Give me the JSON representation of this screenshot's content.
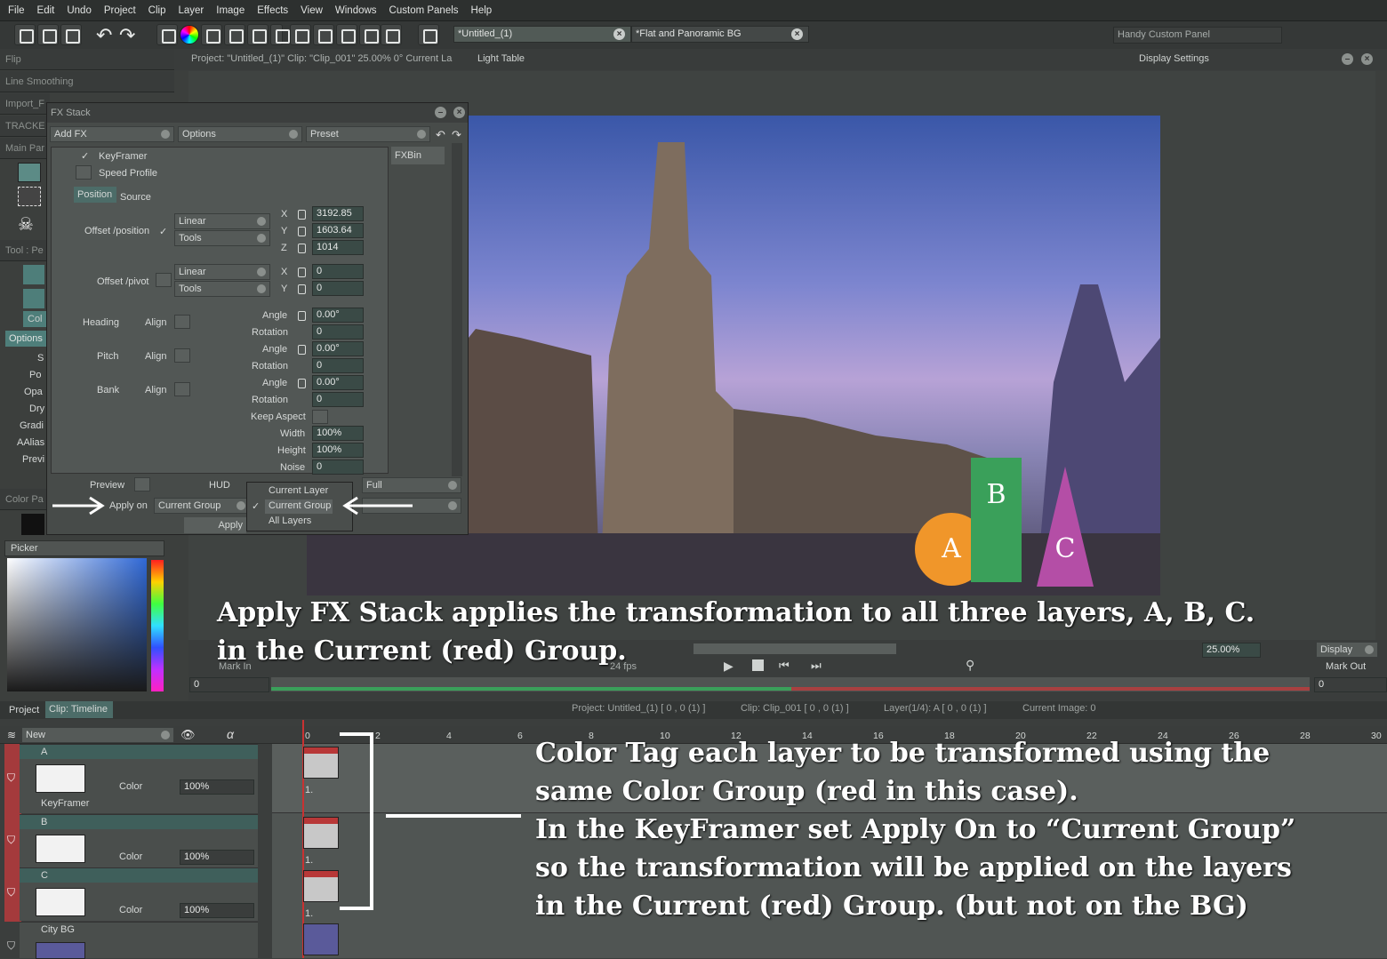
{
  "menu": [
    "File",
    "Edit",
    "Undo",
    "Project",
    "Clip",
    "Layer",
    "Image",
    "Effects",
    "View",
    "Windows",
    "Custom Panels",
    "Help"
  ],
  "tabs": {
    "untitled": "*Untitled_(1)",
    "flat_bg": "*Flat and Panoramic BG",
    "handy": "Handy Custom Panel"
  },
  "left_panels": [
    "Flip",
    "Line Smoothing",
    "Import_F",
    "TRACKE",
    "Main Par"
  ],
  "tool_panel": {
    "title": "Tool : Pe",
    "items": [
      "Col",
      "Options",
      "S",
      "Po",
      "Opa",
      "Dry",
      "Gradi",
      "AAlias",
      "Previ"
    ]
  },
  "color_panel": {
    "title": "Color Pa",
    "picker": "Picker"
  },
  "info_bar": {
    "text": "Project:  \"Untitled_(1)\"  Clip: \"Clip_001\"  25.00%   0°  Current La",
    "light_table": "Light Table",
    "display_settings": "Display Settings"
  },
  "fx": {
    "title": "FX Stack",
    "add_fx": "Add FX",
    "options": "Options",
    "preset": "Preset",
    "fxbin": "FXBin",
    "keyframer": "KeyFramer",
    "speed_profile": "Speed Profile",
    "tab_position": "Position",
    "tab_source": "Source",
    "offset_position": "Offset /position",
    "offset_pivot": "Offset /pivot",
    "linear": "Linear",
    "tools": "Tools",
    "x": "X",
    "y": "Y",
    "z": "Z",
    "pos_x": "3192.85",
    "pos_y": "1603.64",
    "pos_z": "1014",
    "piv_x": "0",
    "piv_y": "0",
    "heading": "Heading",
    "pitch": "Pitch",
    "bank": "Bank",
    "align": "Align",
    "angle": "Angle",
    "rotation": "Rotation",
    "heading_angle": "0.00°",
    "heading_rot": "0",
    "pitch_angle": "0.00°",
    "pitch_rot": "0",
    "bank_angle": "0.00°",
    "bank_rot": "0",
    "keep_aspect": "Keep Aspect",
    "width": "Width",
    "height": "Height",
    "noise": "Noise",
    "width_val": "100%",
    "height_val": "100%",
    "noise_val": "0",
    "preview": "Preview",
    "hud": "HUD",
    "full": "Full",
    "apply_on": "Apply on",
    "apply_on_value": "Current Group",
    "apply": "Apply",
    "menu_options": [
      "Current Layer",
      "Current Group",
      "All Layers"
    ]
  },
  "canvas": {
    "shape_a": "A",
    "shape_b": "B",
    "shape_c": "C"
  },
  "canvas_colors": {
    "a": "#f0962a",
    "b": "#3aa05a",
    "c": "#b44ea6"
  },
  "captions": {
    "top_line1": "Apply FX Stack applies the transformation to all three layers, A, B, C.",
    "top_line2": "in the Current (red) Group.",
    "right_line1": "Color Tag each layer to be transformed using the",
    "right_line2": "same Color Group (red in this case).",
    "right_line3": "In the KeyFramer set Apply On to “Current Group”",
    "right_line4": "so the transformation will be applied on the layers",
    "right_line5": "in the Current (red) Group. (but not on the BG)"
  },
  "transport": {
    "mark_in": "Mark In",
    "mark_out": "Mark Out",
    "in_val": "0",
    "out_val": "0",
    "fps": "24 fps",
    "zoom": "25.00%",
    "display": "Display"
  },
  "timeline": {
    "project_tab": "Project",
    "clip_tab": "Clip: Timeline",
    "status": [
      "Project: Untitled_(1) [ 0 , 0  (1) ]",
      "Clip: Clip_001 [ 0 , 0  (1) ]",
      "Layer(1/4): A [ 0 , 0  (1) ]",
      "Current Image: 0"
    ],
    "new": "New",
    "ruler": [
      "0",
      "2",
      "4",
      "6",
      "8",
      "10",
      "12",
      "14",
      "16",
      "18",
      "20",
      "22",
      "24",
      "26",
      "28",
      "30"
    ],
    "layers": [
      {
        "name": "A",
        "mode": "Color",
        "opacity": "100%",
        "sub": "KeyFramer"
      },
      {
        "name": "B",
        "mode": "Color",
        "opacity": "100%"
      },
      {
        "name": "C",
        "mode": "Color",
        "opacity": "100%"
      },
      {
        "name": "City BG"
      }
    ],
    "frame_label": "1."
  }
}
